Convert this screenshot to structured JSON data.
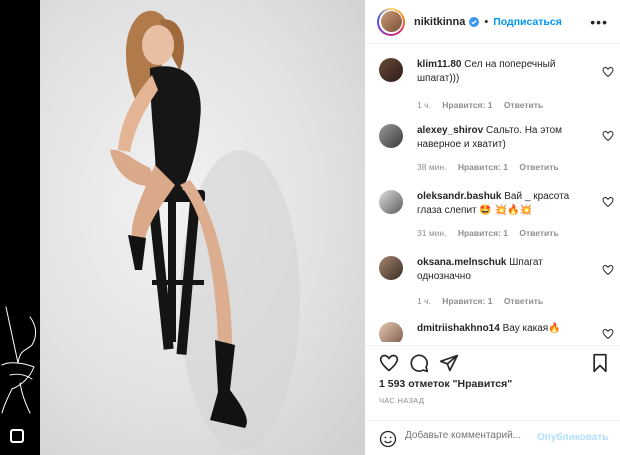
{
  "post": {
    "username": "nikitkinna",
    "follow_label": "Подписаться",
    "more_icon": "more-horizontal-icon",
    "likes_text": "1 593 отметок \"Нравится\"",
    "timestamp": "ЧАС НАЗАД"
  },
  "comments": [
    {
      "user": "klim11.80",
      "text": "Сел на поперечный шпагат)))",
      "time": "1 ч.",
      "likes": "Нравится: 1",
      "reply": "Ответить"
    },
    {
      "user": "alexey_shirov",
      "text": "Сальто. На этом наверное и хватит)",
      "time": "38 мин.",
      "likes": "Нравится: 1",
      "reply": "Ответить"
    },
    {
      "user": "oleksandr.bashuk",
      "text": "Вай _ красота глаза слепит 🤩 💥🔥💥",
      "time": "31 мин.",
      "likes": "Нравится: 1",
      "reply": "Ответить"
    },
    {
      "user": "oksana.melnschuk",
      "text": "Шпагат однозначно",
      "time": "1 ч.",
      "likes": "Нравится: 1",
      "reply": "Ответить"
    },
    {
      "user": "dmitriishakhno14",
      "text": "Вау какая🔥"
    }
  ],
  "add_comment": {
    "placeholder": "Добавьте комментарий...",
    "publish_label": "Опубликовать"
  },
  "colors": {
    "accent": "#0095f6",
    "publish_disabled": "#b2dffc",
    "muted": "#8e8e8e"
  }
}
